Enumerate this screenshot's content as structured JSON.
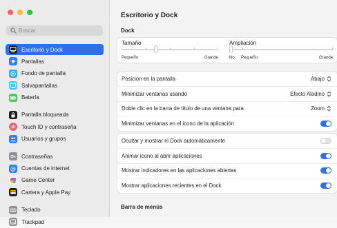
{
  "window": {
    "traffic_lights": {
      "close": "#fe5f57",
      "minimize": "#febc2e",
      "zoom": "#28c840"
    }
  },
  "sidebar": {
    "search_placeholder": "Buscar",
    "items": [
      {
        "label": "Escritorio y Dock",
        "icon": "dock-icon",
        "color": "#1b1b1b",
        "selected": true
      },
      {
        "label": "Pantallas",
        "icon": "display-icon",
        "color": "#2f7cf6"
      },
      {
        "label": "Fondo de pantalla",
        "icon": "wallpaper-icon",
        "color": "#35a8f0"
      },
      {
        "label": "Salvapantallas",
        "icon": "screensaver-icon",
        "color": "#5bbcf5"
      },
      {
        "label": "Batería",
        "icon": "battery-icon",
        "color": "#4cc857"
      },
      {
        "label": "Pantalla bloqueada",
        "icon": "lock-screen-icon",
        "color": "#1b1b1b"
      },
      {
        "label": "Touch ID y contraseña",
        "icon": "touch-id-icon",
        "color": "#f0607a"
      },
      {
        "label": "Usuarios y grupos",
        "icon": "users-icon",
        "color": "#2f7cf6"
      },
      {
        "label": "Contraseñas",
        "icon": "key-icon",
        "color": "#8e8e93"
      },
      {
        "label": "Cuentas de internet",
        "icon": "at-icon",
        "color": "#2f7cf6"
      },
      {
        "label": "Game Center",
        "icon": "game-center-icon",
        "color": "#ffffff"
      },
      {
        "label": "Cartera y Apple Pay",
        "icon": "wallet-icon",
        "color": "#1b1b1b"
      },
      {
        "label": "Teclado",
        "icon": "keyboard-icon",
        "color": "#8e8e93"
      },
      {
        "label": "Trackpad",
        "icon": "trackpad-icon",
        "color": "#8e8e93"
      }
    ]
  },
  "main": {
    "title": "Escritorio y Dock",
    "dock_section": "Dock",
    "size": {
      "title": "Tamaño",
      "min_label": "Pequeño",
      "max_label": "Grande",
      "value": 0.35
    },
    "magnification": {
      "title": "Ampliación",
      "no_label": "No",
      "min_label": "Pequeño",
      "max_label": "Grande",
      "value": 0.0
    },
    "popups": [
      {
        "label": "Posición en la pantalla",
        "value": "Abajo"
      },
      {
        "label": "Minimizar ventanas usando",
        "value": "Efecto Aladino"
      },
      {
        "label": "Doble clic en la barra de título de una ventana para",
        "value": "Zoom"
      }
    ],
    "toggle_minimize_into_icon": {
      "label": "Minimizar ventanas en el icono de la aplicación",
      "on": true
    },
    "toggles": [
      {
        "label": "Ocultar y mostrar el Dock automáticamente",
        "on": false
      },
      {
        "label": "Animar icono al abrir aplicaciones",
        "on": true
      },
      {
        "label": "Mostrar indicadores en las aplicaciones abiertas",
        "on": true
      },
      {
        "label": "Mostrar aplicaciones recientes en el Dock",
        "on": true
      }
    ],
    "menubar_section": "Barra de menús"
  },
  "colors": {
    "accent": "#2f6fe8",
    "toggle_off": "#e3e3e3"
  }
}
